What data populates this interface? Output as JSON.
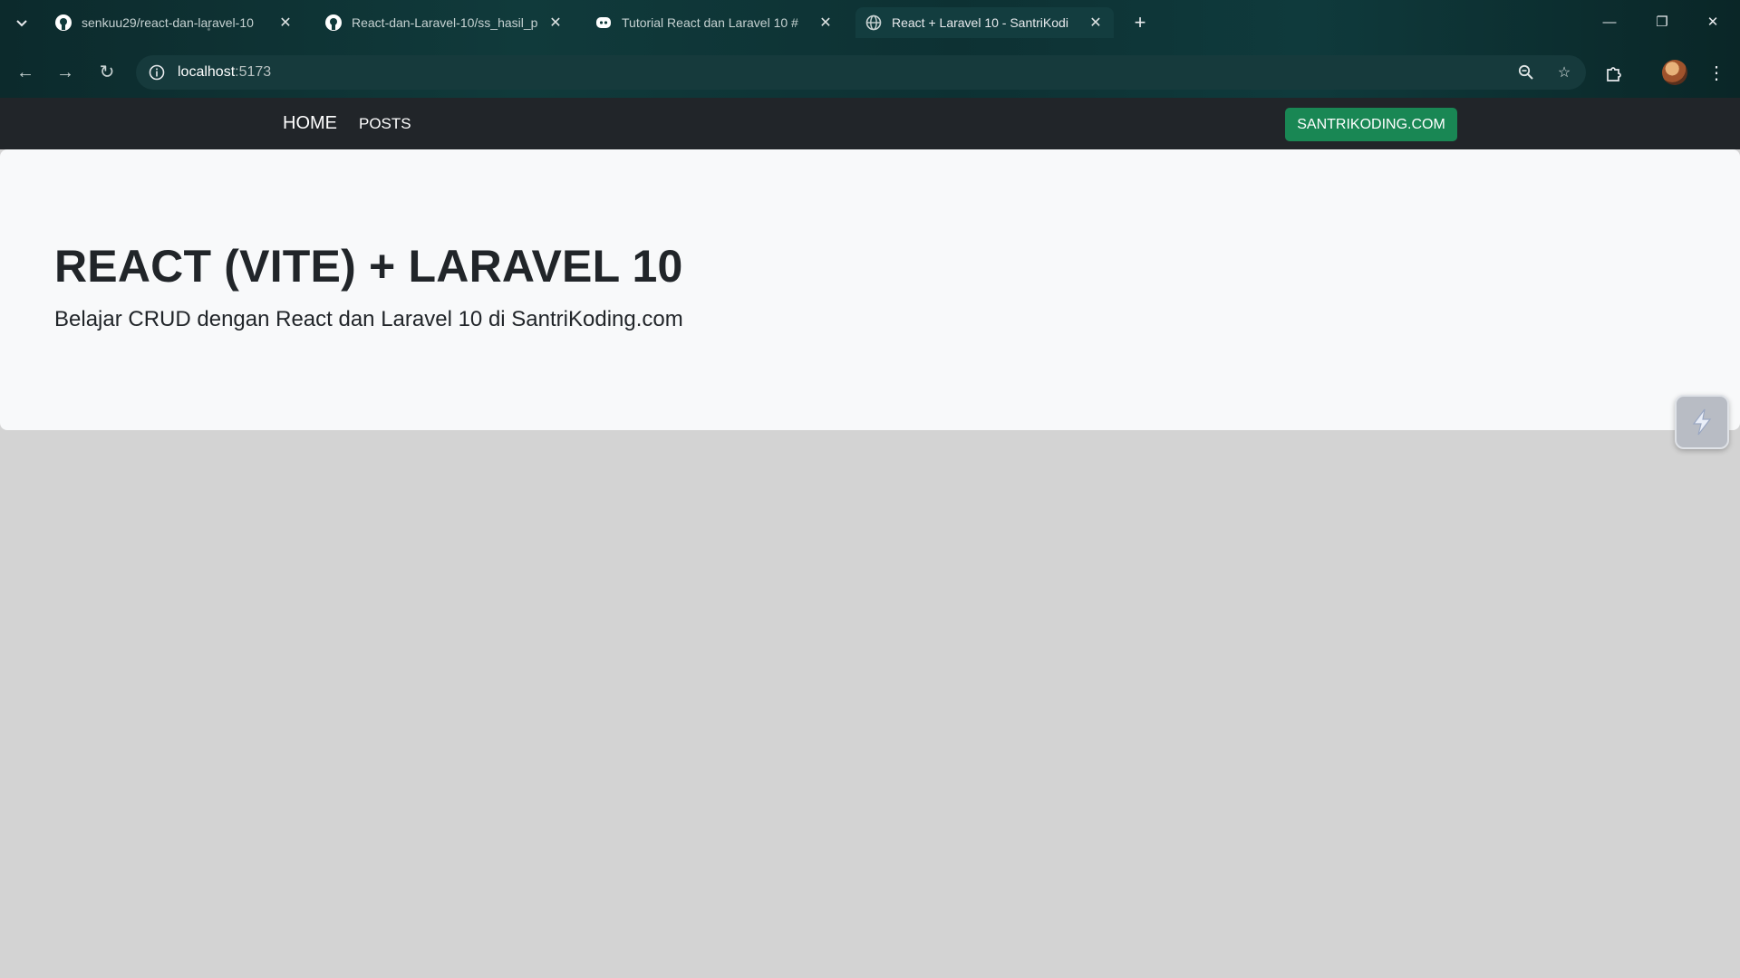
{
  "browser": {
    "tabs": [
      {
        "title": "senkuu29/react-dan-laravel-10",
        "favicon": "github-icon",
        "active": false
      },
      {
        "title": "React-dan-Laravel-10/ss_hasil_p",
        "favicon": "github-icon",
        "active": false
      },
      {
        "title": "Tutorial React dan Laravel 10 #",
        "favicon": "discord-icon",
        "active": false
      },
      {
        "title": "React + Laravel 10 - SantriKodi",
        "favicon": "globe-icon",
        "active": true
      }
    ],
    "address": {
      "host": "localhost",
      "port": ":5173"
    }
  },
  "navbar": {
    "home_label": "HOME",
    "posts_label": "POSTS",
    "cta_label": "SANTRIKODING.COM"
  },
  "hero": {
    "title": "REACT (VITE) + LARAVEL 10",
    "subtitle": "Belajar CRUD dengan React dan Laravel 10 di SantriKoding.com"
  },
  "colors": {
    "navbar_bg": "#212529",
    "cta_bg": "#198754",
    "hero_bg": "#f8f9fa",
    "page_bg": "#d3d3d3"
  }
}
